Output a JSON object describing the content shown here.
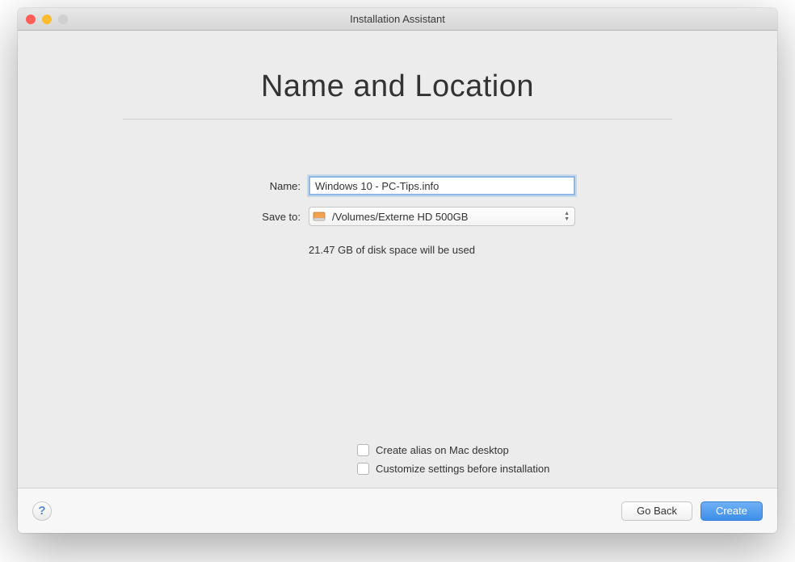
{
  "window": {
    "title": "Installation Assistant"
  },
  "page": {
    "title": "Name and Location"
  },
  "form": {
    "name_label": "Name:",
    "name_value": "Windows 10 - PC-Tips.info",
    "saveto_label": "Save to:",
    "saveto_value": "/Volumes/Externe HD 500GB",
    "disk_usage": "21.47 GB of disk space will be used"
  },
  "options": {
    "alias_label": "Create alias on Mac desktop",
    "customize_label": "Customize settings before installation"
  },
  "footer": {
    "help": "?",
    "go_back": "Go Back",
    "create": "Create"
  }
}
